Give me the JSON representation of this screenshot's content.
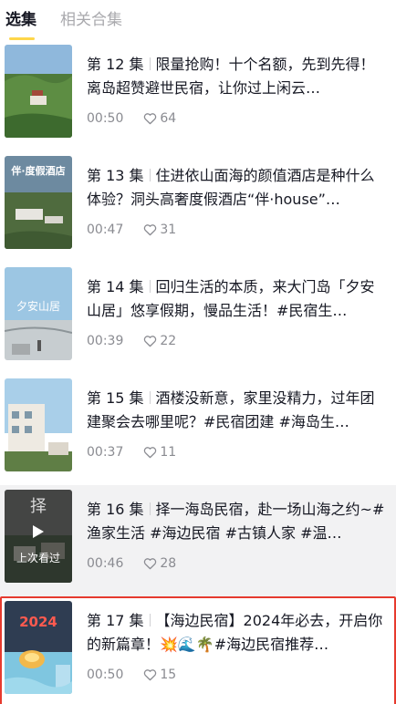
{
  "tabs": [
    {
      "label": "选集"
    },
    {
      "label": "相关合集"
    }
  ],
  "episodes": [
    {
      "episode": "第 12 集",
      "title": "限量抢购！十个名额，先到先得！离岛超赞避世民宿，让你过上闲云…",
      "duration": "00:50",
      "likes": "64"
    },
    {
      "episode": "第 13 集",
      "title": "住进依山面海的颜值酒店是种什么体验？洞头高奢度假酒店“伴·house”…",
      "duration": "00:47",
      "likes": "31",
      "thumb_text": "伴·度假酒店"
    },
    {
      "episode": "第 14 集",
      "title": "回归生活的本质，来大门岛「夕安山居」悠享假期，慢品生活！#民宿生…",
      "duration": "00:39",
      "likes": "22",
      "thumb_text": "夕安山居"
    },
    {
      "episode": "第 15 集",
      "title": "酒楼没新意，家里没精力，过年团建聚会去哪里呢？#民宿团建 #海岛生…",
      "duration": "00:37",
      "likes": "11"
    },
    {
      "episode": "第 16 集",
      "title": "择一海岛民宿，赴一场山海之约~#渔家生活 #海边民宿 #古镇人家 #温…",
      "duration": "00:46",
      "likes": "28",
      "badge": "上次看过",
      "thumb_text": "择"
    },
    {
      "episode": "第 17 集",
      "title": "【海边民宿】2024年必去，开启你的新篇章！💥🌊🌴#海边民宿推荐…",
      "duration": "00:50",
      "likes": "15",
      "thumb_text": "2024"
    }
  ],
  "colors": {
    "accent": "#fed64a",
    "highlight_border": "#e63a2e",
    "meta": "#8a8b91"
  }
}
